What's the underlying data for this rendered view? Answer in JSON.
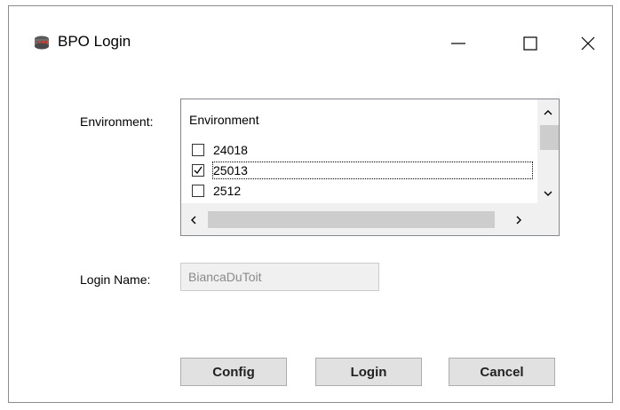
{
  "window": {
    "title": "BPO Login",
    "icon": "app-icon",
    "controls": [
      "minimize-icon",
      "maximize-icon",
      "close-icon"
    ]
  },
  "environment": {
    "label": "Environment:",
    "list_header": "Environment",
    "items": [
      {
        "label": "24018",
        "checked": false
      },
      {
        "label": "25013",
        "checked": true,
        "focused": true
      },
      {
        "label": "2512",
        "checked": false
      }
    ]
  },
  "login": {
    "label": "Login Name:",
    "value": "BiancaDuToit"
  },
  "buttons": {
    "config": "Config",
    "login": "Login",
    "cancel": "Cancel"
  },
  "colors": {
    "window_bg": "#f0f0f0",
    "content_bg": "#ffffff",
    "button_bg": "#e1e1e1",
    "scrollbar_thumb": "#cdcdcd"
  }
}
